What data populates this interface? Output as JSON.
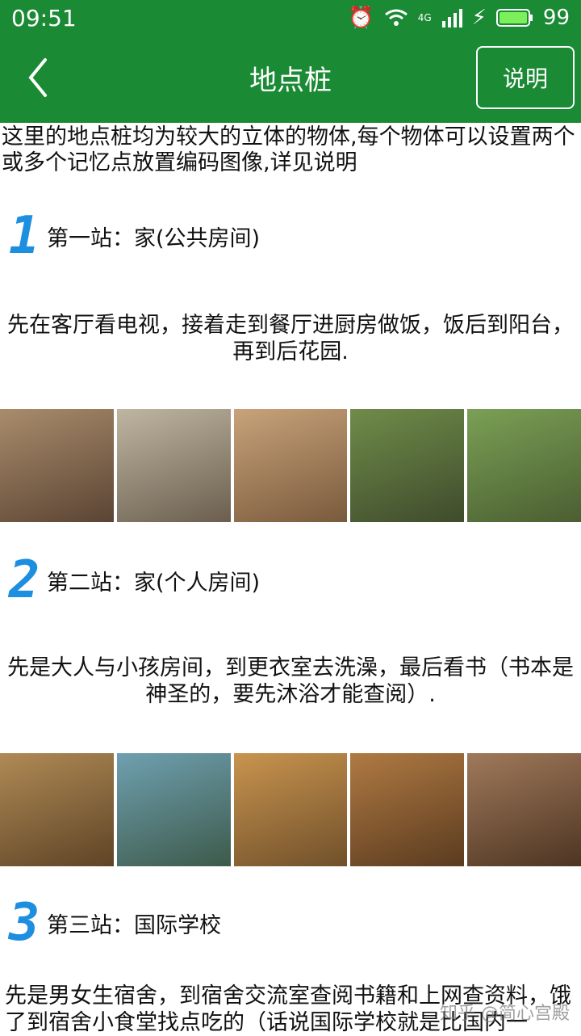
{
  "status": {
    "time": "09:51",
    "network": "4G",
    "battery": "99"
  },
  "app": {
    "title": "地点桩",
    "help_label": "说明"
  },
  "intro": "这里的地点桩均为较大的立体的物体,每个物体可以设置两个或多个记忆点放置编码图像,详见说明",
  "stops": [
    {
      "num": "1",
      "title": "第一站：家(公共房间)",
      "desc": "先在客厅看电视，接着走到餐厅进厨房做饭，饭后到阳台，再到后花园.",
      "images": [
        "living-room",
        "dining-room",
        "kitchen",
        "balcony",
        "garden"
      ],
      "colors": [
        [
          "#a98c6b",
          "#5b4434"
        ],
        [
          "#bfb6a2",
          "#6b5e4e"
        ],
        [
          "#c8a37a",
          "#7a5a3d"
        ],
        [
          "#6f8c4a",
          "#3f4b2c"
        ],
        [
          "#7aa055",
          "#4b5e32"
        ]
      ]
    },
    {
      "num": "2",
      "title": "第二站：家(个人房间)",
      "desc": "先是大人与小孩房间，到更衣室去洗澡，最后看书（书本是神圣的，要先沐浴才能查阅）.",
      "images": [
        "kids-room",
        "play-room",
        "dressing-room",
        "bathroom",
        "study"
      ],
      "colors": [
        [
          "#b08a55",
          "#5e4426"
        ],
        [
          "#6fa0b0",
          "#3d5a4b"
        ],
        [
          "#c9944f",
          "#70502a"
        ],
        [
          "#b07a43",
          "#5a3b1f"
        ],
        [
          "#a0795a",
          "#4d3523"
        ]
      ]
    },
    {
      "num": "3",
      "title": "第三站：国际学校",
      "desc": "先是男女生宿舍，到宿舍交流室查阅书籍和上网查资料，饿了到宿舍小食堂找点吃的（话说国际学校就是比国内一"
    }
  ],
  "watermark": "知乎 @简心宫殿"
}
